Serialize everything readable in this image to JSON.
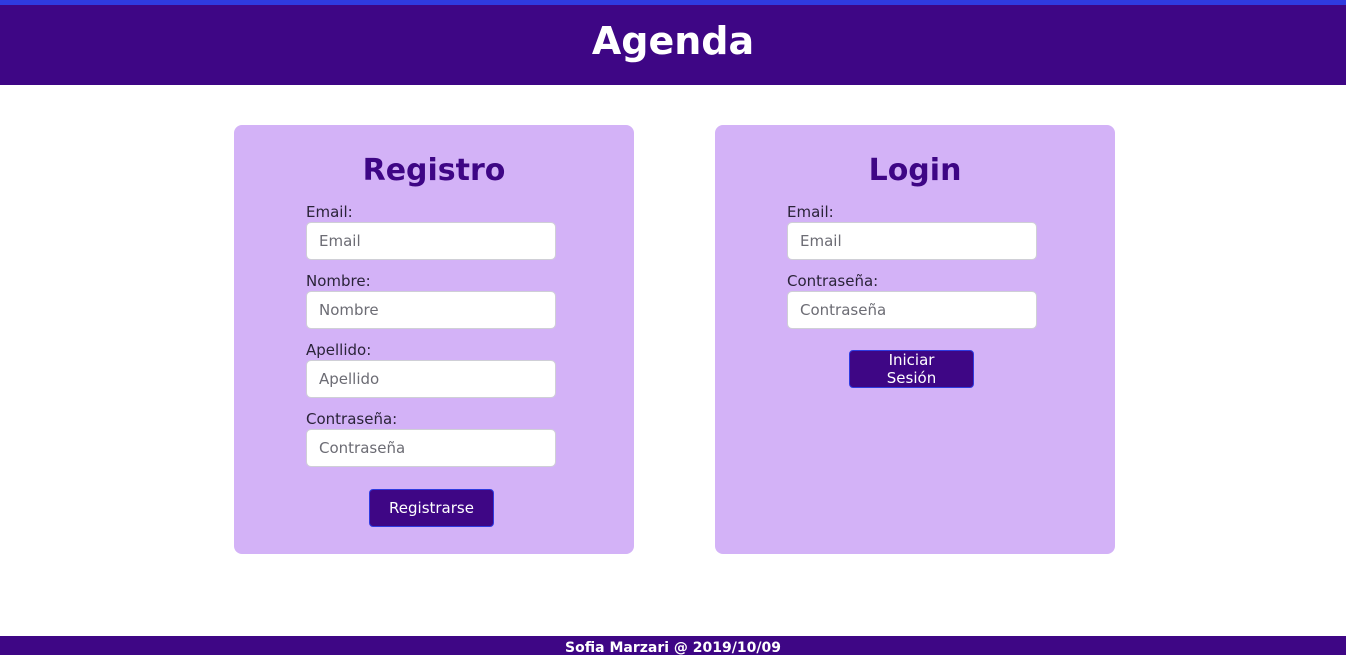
{
  "header": {
    "title": "Agenda"
  },
  "registro": {
    "title": "Registro",
    "fields": [
      {
        "label": "Email:",
        "placeholder": "Email",
        "value": ""
      },
      {
        "label": "Nombre:",
        "placeholder": "Nombre",
        "value": ""
      },
      {
        "label": "Apellido:",
        "placeholder": "Apellido",
        "value": ""
      },
      {
        "label": "Contraseña:",
        "placeholder": "Contraseña",
        "value": ""
      }
    ],
    "submit_label": "Registrarse"
  },
  "login": {
    "title": "Login",
    "fields": [
      {
        "label": "Email:",
        "placeholder": "Email",
        "value": ""
      },
      {
        "label": "Contraseña:",
        "placeholder": "Contraseña",
        "value": ""
      }
    ],
    "submit_label": "Iniciar Sesión"
  },
  "footer": {
    "text": "Sofia Marzari @ 2019/10/09"
  },
  "colors": {
    "header_bg": "#3e0685",
    "card_bg": "#d3b2f7",
    "accent_line": "#2f3be0",
    "title_text": "#3e0685"
  }
}
